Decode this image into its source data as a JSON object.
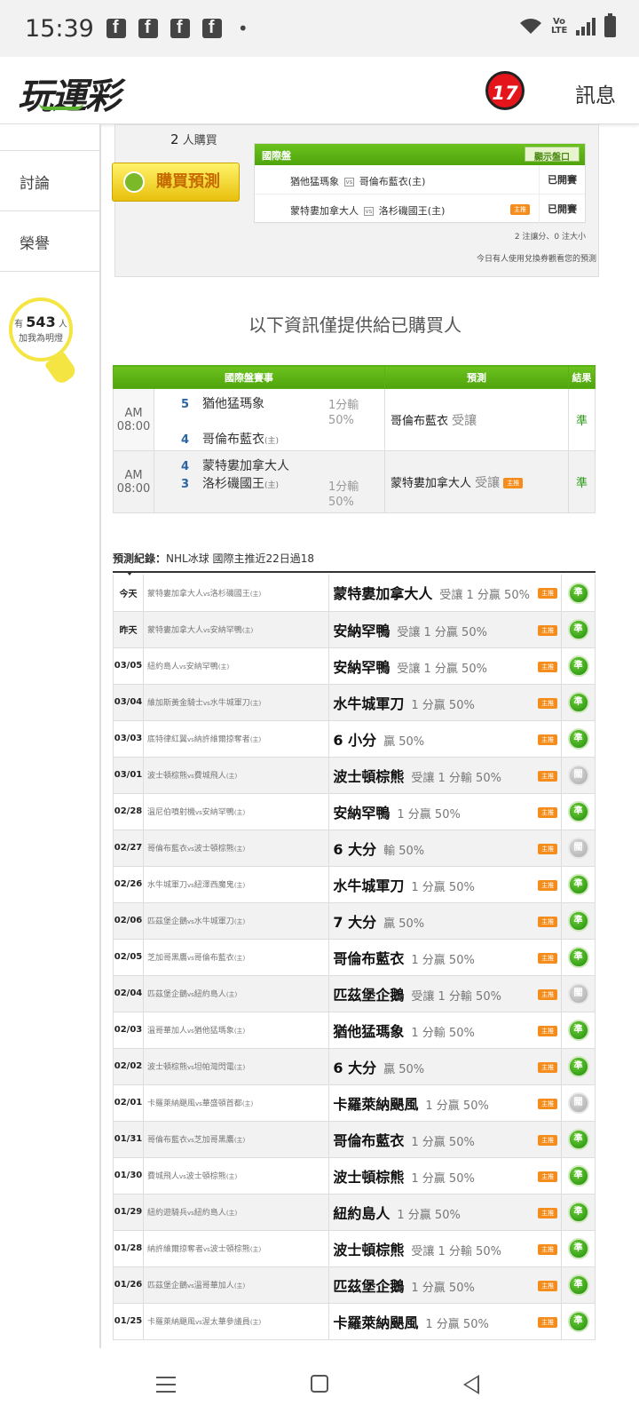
{
  "status": {
    "time": "15:39",
    "dot": "•",
    "volte": "Vo LTE"
  },
  "header": {
    "logo": "玩運彩",
    "badge": "17",
    "message": "訊息"
  },
  "sidebar": {
    "items": [
      {
        "label": "討論"
      },
      {
        "label": "榮譽"
      }
    ],
    "bulb": {
      "prefix": "有",
      "count": "543",
      "suffix": "人",
      "caption": "加我為明燈"
    }
  },
  "top": {
    "buyers_count": "2",
    "buyers_label": "人購買",
    "buy_button": "購買預測",
    "intl": {
      "title": "國際盤",
      "show_odds": "顯示盤口",
      "rows": [
        {
          "away": "猶他猛瑪象",
          "home": "哥倫布藍衣(主)",
          "status": "已開賽",
          "tag": ""
        },
        {
          "away": "蒙特婁加拿大人",
          "home": "洛杉磯國王(主)",
          "status": "已開賽",
          "tag": "主推"
        }
      ]
    },
    "note1": "2 注讓分、0 注大小",
    "note2": "今日有人使用兌換券觀看您的預測"
  },
  "info_title": "以下資訊僅提供給已購買人",
  "prediction": {
    "headers": [
      "國際盤賽事",
      "預測",
      "結果"
    ],
    "rows": [
      {
        "time": "AM 08:00",
        "away_no": "5",
        "away": "猶他猛瑪象",
        "home_no": "4",
        "home": "哥倫布藍衣",
        "home_tag": "(主)",
        "odds1": "1分輸",
        "odds2": "50%",
        "pick": "哥倫布藍衣",
        "give": "受讓",
        "tag": "",
        "result": "準"
      },
      {
        "time": "AM 08:00",
        "away_no": "4",
        "away": "蒙特婁加拿大人",
        "home_no": "3",
        "home": "洛杉磯國王",
        "home_tag": "(主)",
        "odds1": "1分輸",
        "odds2": "50%",
        "pick": "蒙特婁加拿大人",
        "give": "受讓",
        "tag": "主推",
        "result": "準"
      }
    ]
  },
  "records": {
    "title_bold": "預測紀錄：",
    "title": "NHL冰球 國際主推近22日過18",
    "vs": "vs",
    "rows": [
      {
        "date": "今天",
        "away": "蒙特婁加拿大人",
        "home": "洛杉磯國王",
        "pick": "蒙特婁加拿大人",
        "detail": "受讓 1 分贏 50%",
        "tag": "主推",
        "result": "準"
      },
      {
        "date": "昨天",
        "away": "蒙特婁加拿大人",
        "home": "安納罕鴨",
        "pick": "安納罕鴨",
        "detail": "受讓 1 分贏 50%",
        "tag": "主推",
        "result": "準"
      },
      {
        "date": "03/05",
        "away": "紐約島人",
        "home": "安納罕鴨",
        "pick": "安納罕鴨",
        "detail": "受讓 1 分贏 50%",
        "tag": "主推",
        "result": "準"
      },
      {
        "date": "03/04",
        "away": "維加斯黃金騎士",
        "home": "水牛城軍刀",
        "pick": "水牛城軍刀",
        "detail": "1 分贏 50%",
        "tag": "主推",
        "result": "準"
      },
      {
        "date": "03/03",
        "away": "底特律紅翼",
        "home": "納許維爾掠奪者",
        "pick": "6 小分",
        "detail": "贏 50%",
        "tag": "主推",
        "result": "準"
      },
      {
        "date": "03/01",
        "away": "波士頓棕熊",
        "home": "費城飛人",
        "pick": "波士頓棕熊",
        "detail": "受讓 1 分輸 50%",
        "tag": "主推",
        "result": "闊"
      },
      {
        "date": "02/28",
        "away": "溫尼伯噴射機",
        "home": "安納罕鴨",
        "pick": "安納罕鴨",
        "detail": "1 分贏 50%",
        "tag": "主推",
        "result": "準"
      },
      {
        "date": "02/27",
        "away": "哥倫布藍衣",
        "home": "波士頓棕熊",
        "pick": "6 大分",
        "detail": "輸 50%",
        "tag": "主推",
        "result": "闊"
      },
      {
        "date": "02/26",
        "away": "水牛城軍刀",
        "home": "紐澤西魔鬼",
        "pick": "水牛城軍刀",
        "detail": "1 分贏 50%",
        "tag": "主推",
        "result": "準"
      },
      {
        "date": "02/06",
        "away": "匹茲堡企鵝",
        "home": "水牛城軍刀",
        "pick": "7 大分",
        "detail": "贏 50%",
        "tag": "主推",
        "result": "準"
      },
      {
        "date": "02/05",
        "away": "芝加哥黑鷹",
        "home": "哥倫布藍衣",
        "pick": "哥倫布藍衣",
        "detail": "1 分贏 50%",
        "tag": "主推",
        "result": "準"
      },
      {
        "date": "02/04",
        "away": "匹茲堡企鵝",
        "home": "紐約島人",
        "pick": "匹茲堡企鵝",
        "detail": "受讓 1 分輸 50%",
        "tag": "主推",
        "result": "闊"
      },
      {
        "date": "02/03",
        "away": "溫哥華加人",
        "home": "猶他猛瑪象",
        "pick": "猶他猛瑪象",
        "detail": "1 分輸 50%",
        "tag": "主推",
        "result": "準"
      },
      {
        "date": "02/02",
        "away": "波士頓棕熊",
        "home": "坦帕灣閃電",
        "pick": "6 大分",
        "detail": "贏 50%",
        "tag": "主推",
        "result": "準"
      },
      {
        "date": "02/01",
        "away": "卡羅萊納颶風",
        "home": "華盛頓首都",
        "pick": "卡羅萊納颶風",
        "detail": "1 分贏 50%",
        "tag": "主推",
        "result": "闊"
      },
      {
        "date": "01/31",
        "away": "哥倫布藍衣",
        "home": "芝加哥黑鷹",
        "pick": "哥倫布藍衣",
        "detail": "1 分贏 50%",
        "tag": "主推",
        "result": "準"
      },
      {
        "date": "01/30",
        "away": "費城飛人",
        "home": "波士頓棕熊",
        "pick": "波士頓棕熊",
        "detail": "1 分贏 50%",
        "tag": "主推",
        "result": "準"
      },
      {
        "date": "01/29",
        "away": "紐約遊騎兵",
        "home": "紐約島人",
        "pick": "紐約島人",
        "detail": "1 分贏 50%",
        "tag": "主推",
        "result": "準"
      },
      {
        "date": "01/28",
        "away": "納許維爾掠奪者",
        "home": "波士頓棕熊",
        "pick": "波士頓棕熊",
        "detail": "受讓 1 分輸 50%",
        "tag": "主推",
        "result": "準"
      },
      {
        "date": "01/26",
        "away": "匹茲堡企鵝",
        "home": "溫哥華加人",
        "pick": "匹茲堡企鵝",
        "detail": "1 分贏 50%",
        "tag": "主推",
        "result": "準"
      },
      {
        "date": "01/25",
        "away": "卡羅萊納颶風",
        "home": "渥太華參議員",
        "pick": "卡羅萊納颶風",
        "detail": "1 分贏 50%",
        "tag": "主推",
        "result": "準"
      }
    ],
    "home_suffix": "(主)"
  },
  "colors": {
    "green": "#4ea40c",
    "orange": "#f58d1d",
    "red": "#e4151b"
  }
}
